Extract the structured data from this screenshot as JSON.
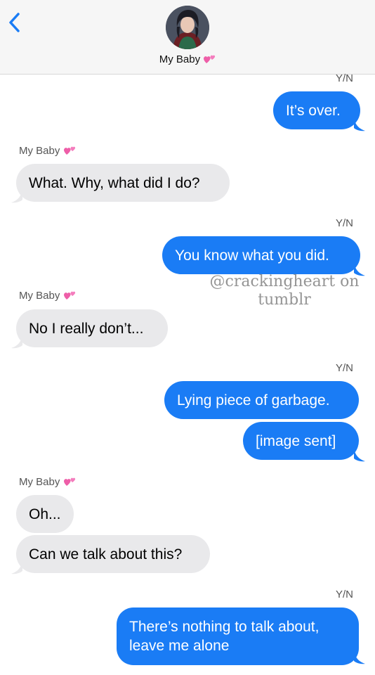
{
  "header": {
    "contact_name": "My Baby",
    "contact_emoji": "two-hearts"
  },
  "labels": {
    "me": "Y/N",
    "them": "My Baby"
  },
  "messages": [
    {
      "from": "me",
      "text": "It’s over."
    },
    {
      "from": "them",
      "text": "What. Why, what did I do?"
    },
    {
      "from": "me",
      "text": "You know what you did."
    },
    {
      "from": "them",
      "text": "No I really don’t..."
    },
    {
      "from": "me",
      "text": "Lying piece of garbage."
    },
    {
      "from": "me",
      "text": "[image sent]"
    },
    {
      "from": "them",
      "text": "Oh..."
    },
    {
      "from": "them",
      "text": "Can we talk about this?"
    },
    {
      "from": "me",
      "text": "There’s nothing to talk about,",
      "text2": "leave me alone"
    }
  ],
  "watermark": {
    "line1": "@crackingheart on",
    "line2": "tumblr"
  },
  "colors": {
    "outgoing": "#1a7cf5",
    "incoming": "#e9e9eb",
    "accent": "#1a7cf5"
  }
}
